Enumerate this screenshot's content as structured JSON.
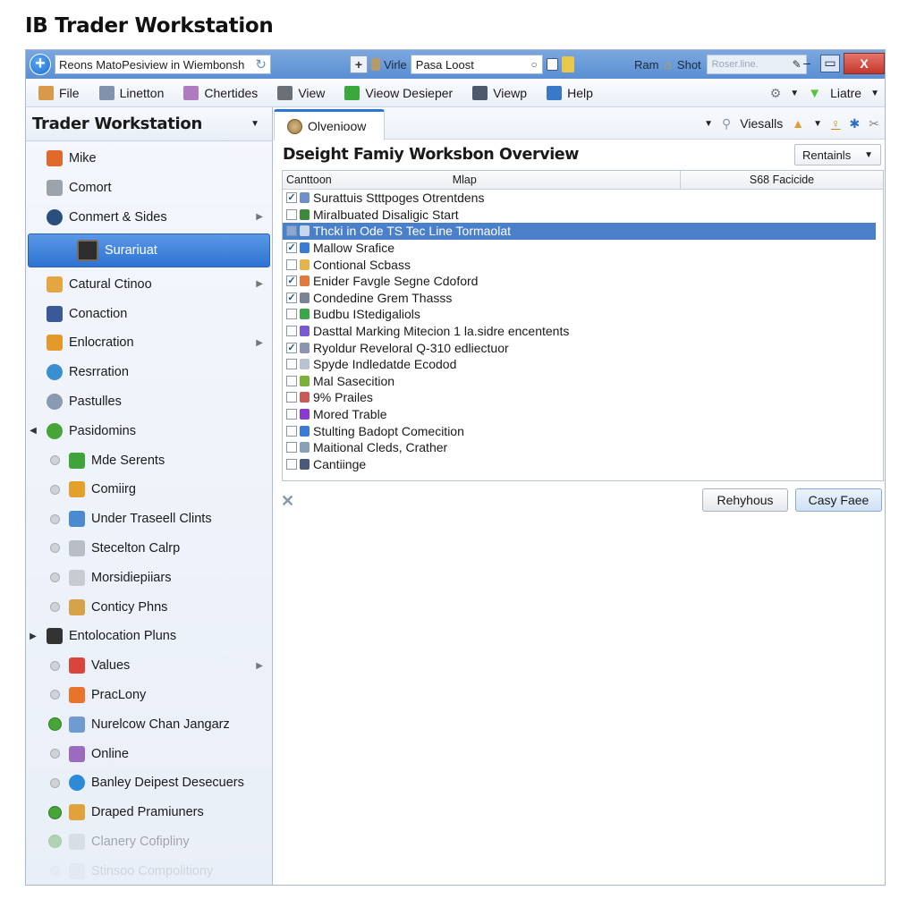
{
  "page_title": "IB Trader Workstation",
  "titlebar": {
    "address_value": "Reons MatoPesiview in Wiembonsh",
    "mid_label": "Virle",
    "mid_field_value": "Pasa Loost",
    "right_label_1": "Ram",
    "right_label_2": "Shot",
    "ghost_field_placeholder": "Roser.line.",
    "minimize": "–",
    "maximize": "▭",
    "close": "X"
  },
  "menubar": {
    "items": [
      {
        "label": "File",
        "icon": "file-icon",
        "color": "#d89a4a"
      },
      {
        "label": "Linetton",
        "icon": "document-icon",
        "color": "#7f93ad"
      },
      {
        "label": "Chertides",
        "icon": "tools-icon",
        "color": "#b07ac0"
      },
      {
        "label": "View",
        "icon": "monitor-icon",
        "color": "#6b7076"
      },
      {
        "label": "Vieow Desieper",
        "icon": "play-icon",
        "color": "#3aa83a"
      },
      {
        "label": "Viewp",
        "icon": "film-icon",
        "color": "#4d5a6b"
      },
      {
        "label": "Help",
        "icon": "help-book-icon",
        "color": "#3a78c8"
      }
    ],
    "right_label": "Liatre"
  },
  "sidebar": {
    "title": "Trader Workstation",
    "items": [
      {
        "label": "Mike",
        "icon": "chart-icon",
        "color": "#e06a2c",
        "type": "top"
      },
      {
        "label": "Comort",
        "icon": "power-icon",
        "color": "#9ca3ad",
        "type": "top"
      },
      {
        "label": "Conmert & Sides",
        "icon": "globe-icon",
        "color": "#2a4f7d",
        "type": "top",
        "arrow": true
      },
      {
        "label": "Surariuat",
        "icon": "photo-icon",
        "color": "#2d2d2d",
        "type": "selected"
      },
      {
        "label": "Catural Ctinoo",
        "icon": "folder-icon",
        "color": "#e3a640",
        "type": "top",
        "arrow": true
      },
      {
        "label": "Conaction",
        "icon": "facebook-icon",
        "color": "#3b5998",
        "type": "top"
      },
      {
        "label": "Enlocration",
        "icon": "tools-icon",
        "color": "#e39a2a",
        "type": "top",
        "arrow": true
      },
      {
        "label": "Resrration",
        "icon": "refresh-icon",
        "color": "#3a8fd0",
        "type": "top"
      },
      {
        "label": "Pastulles",
        "icon": "disc-icon",
        "color": "#8a9ab0",
        "type": "top"
      },
      {
        "label": "Pasidomins",
        "icon": "info-icon",
        "color": "#46a536",
        "type": "top",
        "lead": "◀"
      },
      {
        "label": "Mde Serents",
        "icon": "cube-icon",
        "color": "#3fa53a",
        "type": "child"
      },
      {
        "label": "Comiirg",
        "icon": "stamp-icon",
        "color": "#e3a02c",
        "type": "child"
      },
      {
        "label": "Under Traseell Clints",
        "icon": "calendar-icon",
        "color": "#4a8ad0",
        "type": "child"
      },
      {
        "label": "Stecelton Calrp",
        "icon": "document-icon",
        "color": "#b8bec6",
        "type": "child"
      },
      {
        "label": "Morsidiepiiars",
        "icon": "document-icon",
        "color": "#c8ccd2",
        "type": "child"
      },
      {
        "label": "Conticy Phns",
        "icon": "briefcase-icon",
        "color": "#d6a24a",
        "type": "child"
      },
      {
        "label": "Entolocation Pluns",
        "icon": "grid-icon",
        "color": "#333333",
        "type": "top",
        "lead": "▶"
      },
      {
        "label": "Values",
        "icon": "heart-icon",
        "color": "#d9453a",
        "type": "child",
        "arrow": true
      },
      {
        "label": "PracLony",
        "icon": "flower-icon",
        "color": "#e8742a",
        "type": "child"
      },
      {
        "label": "Nurelcow Chan Jangarz",
        "icon": "computer-icon",
        "color": "#6f9bd0",
        "type": "child-green"
      },
      {
        "label": "Online",
        "icon": "user-icon",
        "color": "#9b6bc0",
        "type": "child"
      },
      {
        "label": "Banley Deipest Desecuers",
        "icon": "globe-icon",
        "color": "#2d8ad8",
        "type": "child"
      },
      {
        "label": "Draped Pramiuners",
        "icon": "folder-icon",
        "color": "#e0a33a",
        "type": "child-green"
      },
      {
        "label": "Clanery Cofipliny",
        "icon": "folder-icon",
        "color": "#b8c0ca",
        "type": "child-green",
        "faded": 1
      },
      {
        "label": "Stinsoo Compolitiony",
        "icon": "folder-icon",
        "color": "#b8c0ca",
        "type": "child",
        "faded": 2
      }
    ]
  },
  "tab": {
    "label": "Olvenioow",
    "tools_label": "Viesalls"
  },
  "content": {
    "title": "Dseight Famiy Worksbon Overview",
    "dropdown_value": "Rentainls",
    "columns": [
      "Canttoon",
      "Mlap",
      "S68 Facicide"
    ],
    "rows": [
      {
        "label": "Surattuis Stttpoges Otrentdens",
        "checked": true,
        "color": "#6e8fc7"
      },
      {
        "label": "Miralbuated Disaligic Start",
        "checked": false,
        "color": "#3d8a3d"
      },
      {
        "label": "Thcki in Ode TS Tec Line Tormaolat",
        "checked": false,
        "color": "#c9d7ea",
        "selected": true
      },
      {
        "label": "Mallow Srafice",
        "checked": true,
        "color": "#3a7bd5"
      },
      {
        "label": "Contional Scbass",
        "checked": false,
        "color": "#e6b44a"
      },
      {
        "label": "Enider Favgle Segne Cdoford",
        "checked": true,
        "color": "#e07a3a"
      },
      {
        "label": "Condedine Grem Thasss",
        "checked": true,
        "color": "#7a8494"
      },
      {
        "label": "Budbu IStedigaliols",
        "checked": false,
        "color": "#3ea44a"
      },
      {
        "label": "Dasttal Marking Mitecion 1 la.sidre encentents",
        "checked": false,
        "color": "#7a5ad0"
      },
      {
        "label": "Ryoldur Reveloral Q-310 edliectuor",
        "checked": true,
        "color": "#8a96b0"
      },
      {
        "label": "Spyde Indledatde Ecodod",
        "checked": false,
        "color": "#b8c2d0"
      },
      {
        "label": "Mal Sasecition",
        "checked": false,
        "color": "#7cb03a"
      },
      {
        "label": "9% Prailes",
        "checked": false,
        "color": "#c85a5a"
      },
      {
        "label": "Mored Trable",
        "checked": false,
        "color": "#8a3ad0"
      },
      {
        "label": "Stulting Badopt Comecition",
        "checked": false,
        "color": "#3a7bd5"
      },
      {
        "label": "Maitional Cleds, Crather",
        "checked": false,
        "color": "#8aa0b8"
      },
      {
        "label": "Cantiinge",
        "checked": false,
        "color": "#4a5a7a"
      }
    ],
    "buttons": {
      "secondary": "Rehyhous",
      "primary": "Casy Faee"
    }
  }
}
